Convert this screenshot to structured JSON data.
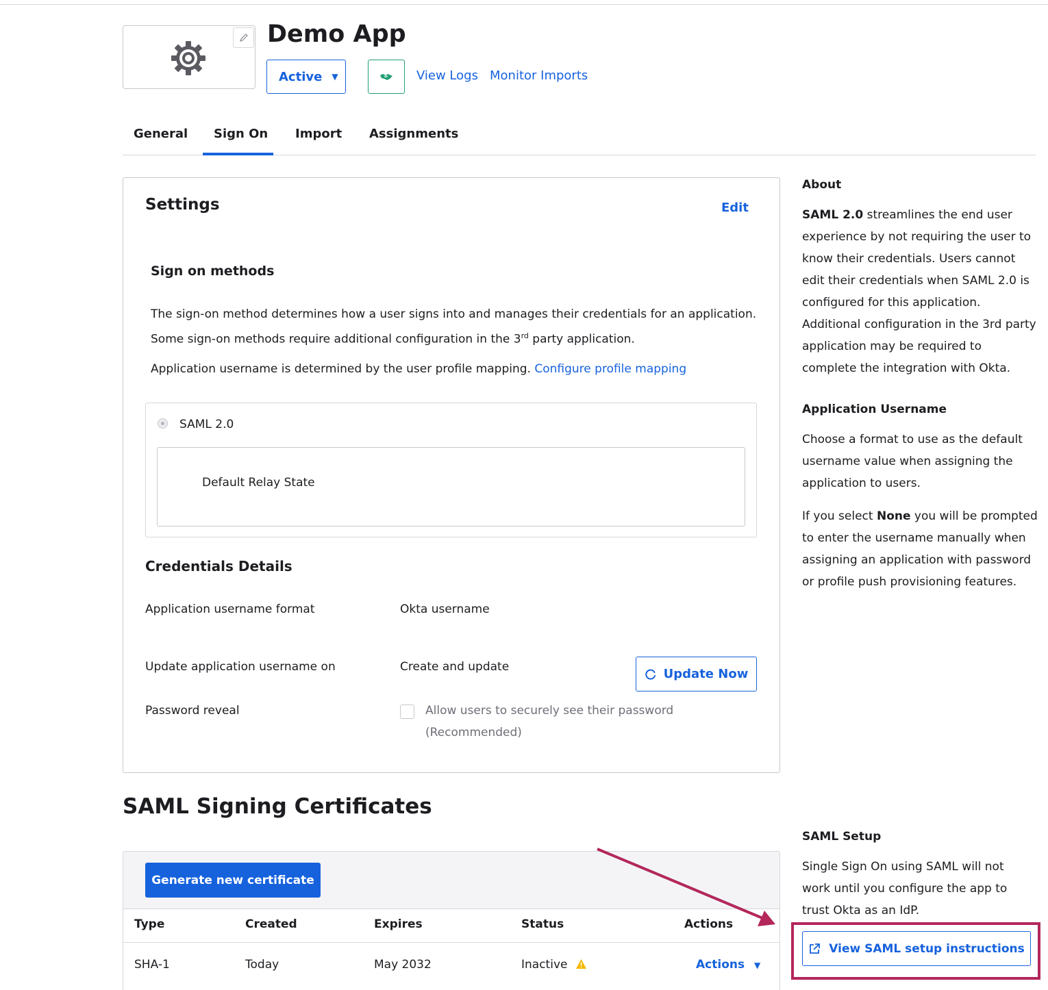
{
  "header": {
    "app_title": "Demo App",
    "status_label": "Active",
    "view_logs": "View Logs",
    "monitor_imports": "Monitor Imports"
  },
  "tabs": [
    {
      "label": "General"
    },
    {
      "label": "Sign On",
      "active": true
    },
    {
      "label": "Import"
    },
    {
      "label": "Assignments"
    }
  ],
  "settings": {
    "title": "Settings",
    "edit": "Edit",
    "methods_title": "Sign on methods",
    "methods_desc_1": "The sign-on method determines how a user signs into and manages their credentials for an application.",
    "methods_desc_2a": "Some sign-on methods require additional configuration in the 3",
    "methods_desc_2sup": "rd",
    "methods_desc_2b": " party application.",
    "username_desc": "Application username is determined by the user profile mapping.",
    "configure_link": "Configure profile mapping",
    "saml_option": "SAML 2.0",
    "relay_state": "Default Relay State",
    "cred_title": "Credentials Details",
    "username_format_label": "Application username format",
    "username_format_value": "Okta username",
    "update_on_label": "Update application username on",
    "update_on_value": "Create and update",
    "update_now": "Update Now",
    "password_reveal_label": "Password reveal",
    "password_reveal_option": "Allow users to securely see their password",
    "password_reveal_note": "(Recommended)"
  },
  "certificates": {
    "title": "SAML Signing Certificates",
    "generate_button": "Generate new certificate",
    "columns": [
      "Type",
      "Created",
      "Expires",
      "Status",
      "Actions"
    ],
    "rows": [
      {
        "type": "SHA-1",
        "created": "Today",
        "expires": "May 2032",
        "status": "Inactive",
        "actions": "Actions"
      }
    ]
  },
  "sidebar": {
    "about_title": "About",
    "about_bold": "SAML 2.0",
    "about_text": " streamlines the end user experience by not requiring the user to know their credentials. Users cannot edit their credentials when SAML 2.0 is configured for this application. Additional configuration in the 3rd party application may be required to complete the integration with Okta.",
    "username_title": "Application Username",
    "username_text": "Choose a format to use as the default username value when assigning the application to users.",
    "none_pre": "If you select ",
    "none_bold": "None",
    "none_post": " you will be prompted to enter the username manually when assigning an application with password or profile push provisioning features.",
    "setup_title": "SAML Setup",
    "setup_text": "Single Sign On using SAML will not work until you configure the app to trust Okta as an IdP.",
    "setup_button": "View SAML setup instructions"
  },
  "colors": {
    "accent": "#1662dd",
    "annotation": "#b3275b",
    "warning": "#f5b800",
    "success": "#1f9e74"
  },
  "icons": [
    "gear-icon",
    "pencil-icon",
    "chevron-down-icon",
    "handshake-icon",
    "refresh-icon",
    "warning-icon",
    "external-link-icon"
  ]
}
